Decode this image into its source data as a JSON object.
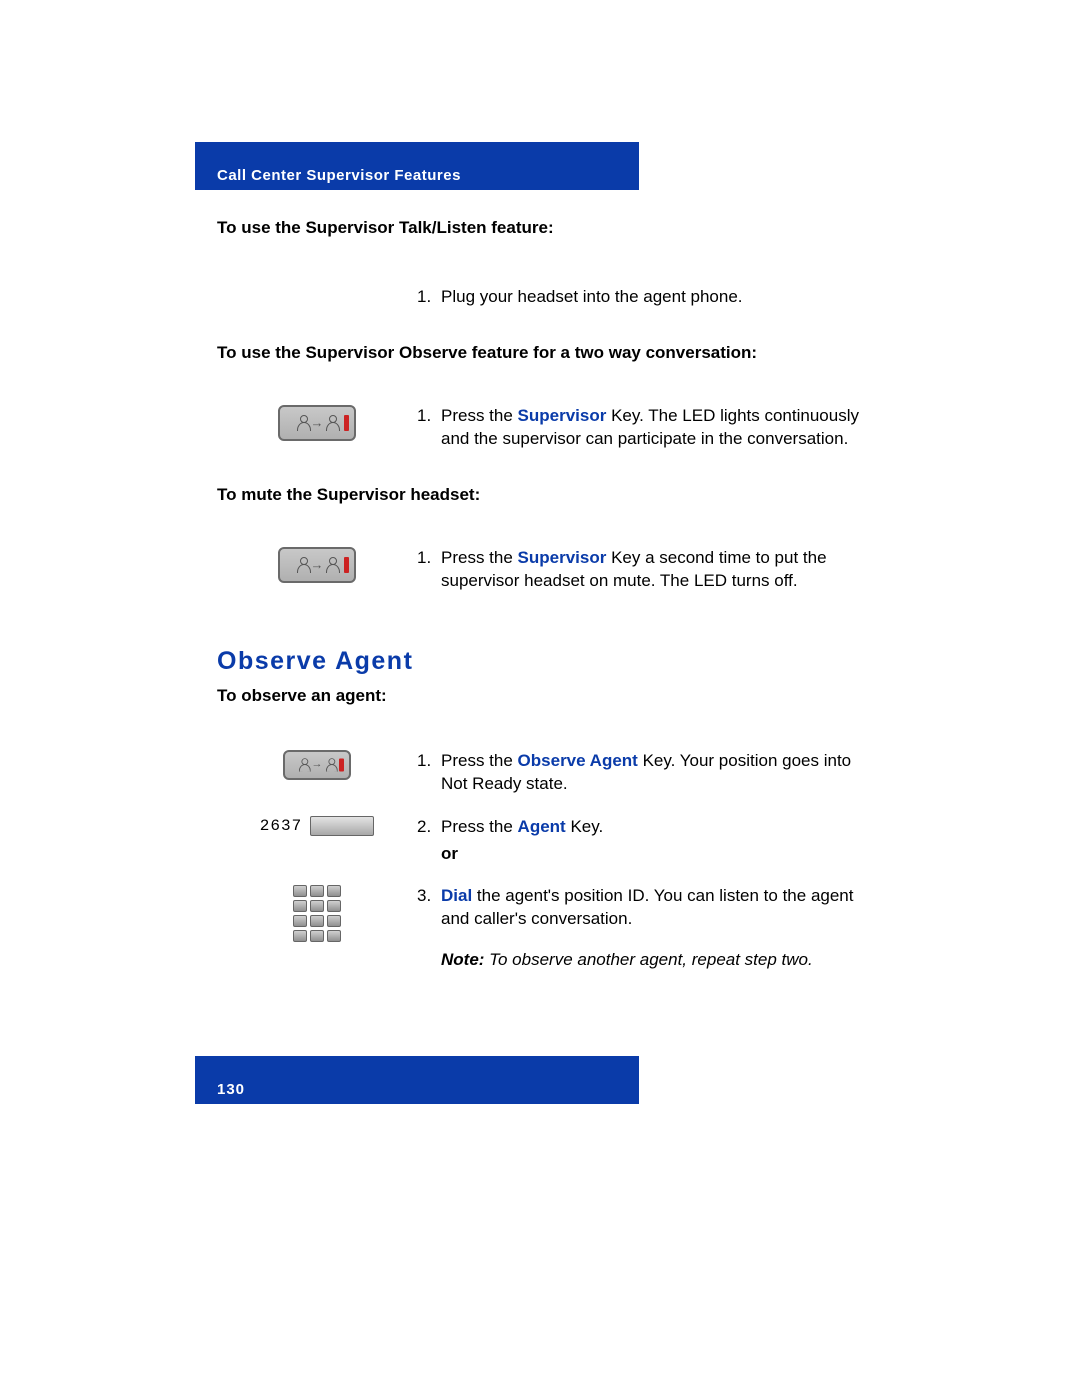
{
  "header": {
    "title": "Call Center Supervisor Features"
  },
  "section1": {
    "title": "To use the Supervisor Talk/Listen feature:",
    "steps": [
      {
        "num": "1.",
        "text": "Plug your headset into the agent phone."
      }
    ]
  },
  "section2": {
    "title": "To use the Supervisor Observe feature for a two way conversation:",
    "steps": [
      {
        "num": "1.",
        "pre": "Press the ",
        "key": "Supervisor",
        "post": " Key. The LED lights continuously and the supervisor can participate in the conversation."
      }
    ]
  },
  "section3": {
    "title": "To mute the Supervisor headset:",
    "steps": [
      {
        "num": "1.",
        "pre": "Press the ",
        "key": "Supervisor",
        "post": " Key a second time to put the supervisor headset on mute. The LED turns off."
      }
    ]
  },
  "observe": {
    "heading": "Observe Agent",
    "subtitle": "To observe an agent:",
    "agent_number": "2637",
    "or_label": "or",
    "note_label": "Note:",
    "steps": [
      {
        "num": "1.",
        "pre": "Press the ",
        "key": "Observe Agent",
        "post": " Key. Your position goes into Not Ready state."
      },
      {
        "num": "2.",
        "pre": "Press the ",
        "key": "Agent",
        "post": " Key."
      },
      {
        "num": "3.",
        "key": "Dial",
        "post": " the agent's position ID. You can listen to the agent and caller's conversation."
      }
    ],
    "note_text": " To observe another agent, repeat step two."
  },
  "footer": {
    "page": "130"
  }
}
